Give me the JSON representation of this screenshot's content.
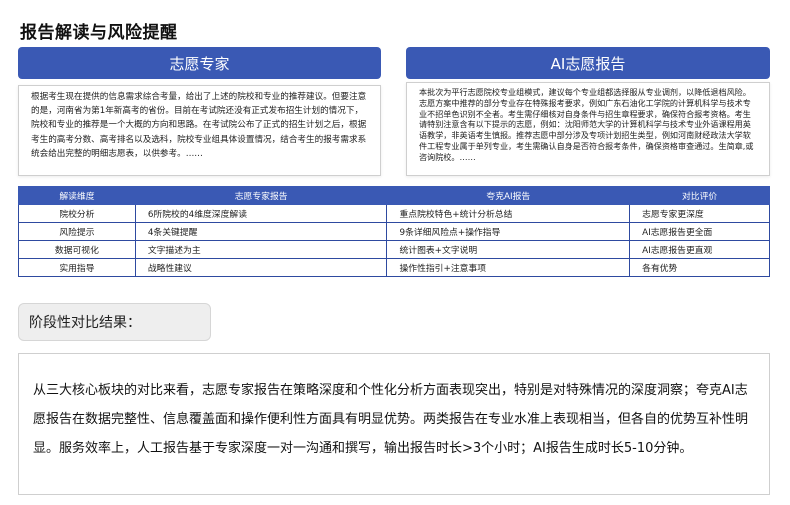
{
  "page_title": "报告解读与风险提醒",
  "expert_panel": {
    "title": "志愿专家",
    "text": "根据考生现在提供的信息需求综合考量，给出了上述的院校和专业的推荐建议。但要注意的是，河南省为第1年新高考的省份。目前在考试院还没有正式发布招生计划的情况下，院校和专业的推荐是一个大概的方向和思路。在考试院公布了正式的招生计划之后，根据考生的高考分数、高考排名以及选科，院校专业组具体设置情况，结合考生的报考需求系统会给出完整的明细志愿表，以供参考。……"
  },
  "ai_panel": {
    "title": "AI志愿报告",
    "text": "本批次为平行志愿院校专业组模式，建议每个专业组都选择服从专业调剂，以降低退档风险。志愿方案中推荐的部分专业存在特殊报考要求，例如广东石油化工学院的计算机科学与技术专业不招单色识别不全者。考生需仔细核对自身条件与招生章程要求，确保符合报考资格。考生请特别注意含有以下提示的志愿，例如：沈阳师范大学的计算机科学与技术专业外语课程用英语教学，非英语考生慎报。推荐志愿中部分涉及专项计划招生类型，例如河南财经政法大学软件工程专业属于单列专业，考生需确认自身是否符合报考条件，确保资格审查通过。生简章,或咨询院校。……"
  },
  "table": {
    "headers": [
      "解读维度",
      "志愿专家报告",
      "夸克AI报告",
      "对比评价"
    ],
    "rows": [
      [
        "院校分析",
        "6所院校的4维度深度解读",
        "重点院校特色+统计分析总结",
        "志愿专家更深度"
      ],
      [
        "风险提示",
        "4条关键提醒",
        "9条详细风险点+操作指导",
        "AI志愿报告更全面"
      ],
      [
        "数据可视化",
        "文字描述为主",
        "统计图表+文字说明",
        "AI志愿报告更直观"
      ],
      [
        "实用指导",
        "战略性建议",
        "操作性指引+注意事项",
        "各有优势"
      ]
    ]
  },
  "stage_label": "阶段性对比结果：",
  "conclusion": "从三大核心板块的对比来看，志愿专家报告在策略深度和个性化分析方面表现突出，特别是对特殊情况的深度洞察；夸克AI志愿报告在数据完整性、信息覆盖面和操作便利性方面具有明显优势。两类报告在专业水准上表现相当，但各自的优势互补性明显。服务效率上，人工报告基于专家深度一对一沟通和撰写，输出报告时长>3个小时；AI报告生成时长5-10分钟。",
  "colors": {
    "accent": "#3a59b4"
  }
}
